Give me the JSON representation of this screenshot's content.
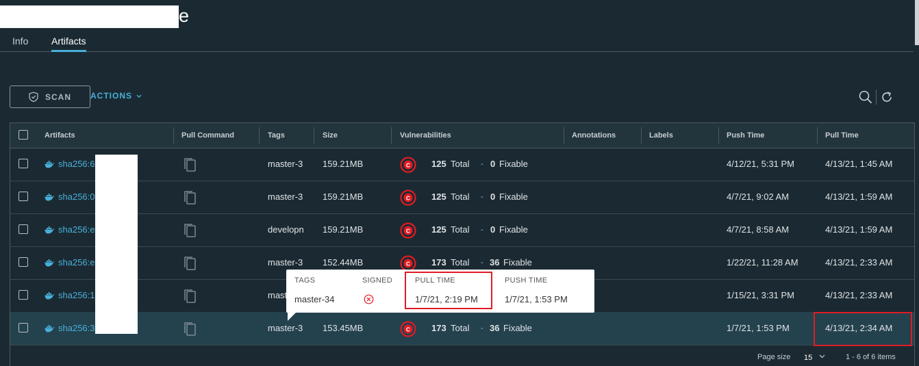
{
  "page": {
    "title_suffix": "e"
  },
  "tabs": [
    {
      "label": "Info"
    },
    {
      "label": "Artifacts",
      "active": true
    }
  ],
  "toolbar": {
    "scan_label": "SCAN",
    "actions_label": "ACTIONS"
  },
  "table": {
    "columns": [
      "Artifacts",
      "Pull Command",
      "Tags",
      "Size",
      "Vulnerabilities",
      "Annotations",
      "Labels",
      "Push Time",
      "Pull Time"
    ],
    "rows": [
      {
        "digest": "sha256:6",
        "tag": "master-3",
        "size": "159.21MB",
        "vuln_total": "125",
        "total_label": "Total",
        "dash": "-",
        "fixable": "0",
        "fixable_label": "Fixable",
        "push_time": "4/12/21, 5:31 PM",
        "pull_time": "4/13/21, 1:45 AM"
      },
      {
        "digest": "sha256:0",
        "tag": "master-3",
        "size": "159.21MB",
        "vuln_total": "125",
        "total_label": "Total",
        "dash": "-",
        "fixable": "0",
        "fixable_label": "Fixable",
        "push_time": "4/7/21, 9:02 AM",
        "pull_time": "4/13/21, 1:59 AM"
      },
      {
        "digest": "sha256:e",
        "tag": "developn",
        "size": "159.21MB",
        "vuln_total": "125",
        "total_label": "Total",
        "dash": "-",
        "fixable": "0",
        "fixable_label": "Fixable",
        "push_time": "4/7/21, 8:58 AM",
        "pull_time": "4/13/21, 1:59 AM"
      },
      {
        "digest": "sha256:e",
        "tag": "master-3",
        "size": "152.44MB",
        "vuln_total": "173",
        "total_label": "Total",
        "dash": "-",
        "fixable": "36",
        "fixable_label": "Fixable",
        "push_time": "1/22/21, 11:28 AM",
        "pull_time": "4/13/21, 2:33 AM"
      },
      {
        "digest": "sha256:1",
        "tag": "mast",
        "size": "",
        "vuln_total": "",
        "total_label": "",
        "dash": "",
        "fixable": "",
        "fixable_label": "",
        "push_time": "1/15/21, 3:31 PM",
        "pull_time": "4/13/21, 2:33 AM"
      },
      {
        "digest": "sha256:3",
        "tag": "master-3",
        "size": "153.45MB",
        "vuln_total": "173",
        "total_label": "Total",
        "dash": "-",
        "fixable": "36",
        "fixable_label": "Fixable",
        "push_time": "1/7/21, 1:53 PM",
        "pull_time": "4/13/21, 2:34 AM"
      }
    ]
  },
  "tooltip": {
    "labels": {
      "tags": "TAGS",
      "signed": "SIGNED",
      "pull_time": "PULL TIME",
      "push_time": "PUSH TIME"
    },
    "tag": "master-34",
    "pull_time": "1/7/21, 2:19 PM",
    "push_time": "1/7/21, 1:53 PM"
  },
  "footer": {
    "page_size_label": "Page size",
    "page_size": "15",
    "items": "1 - 6 of 6 items"
  },
  "colors": {
    "accent": "#49afd9",
    "danger": "#e01b24",
    "background": "#1b2a32"
  }
}
